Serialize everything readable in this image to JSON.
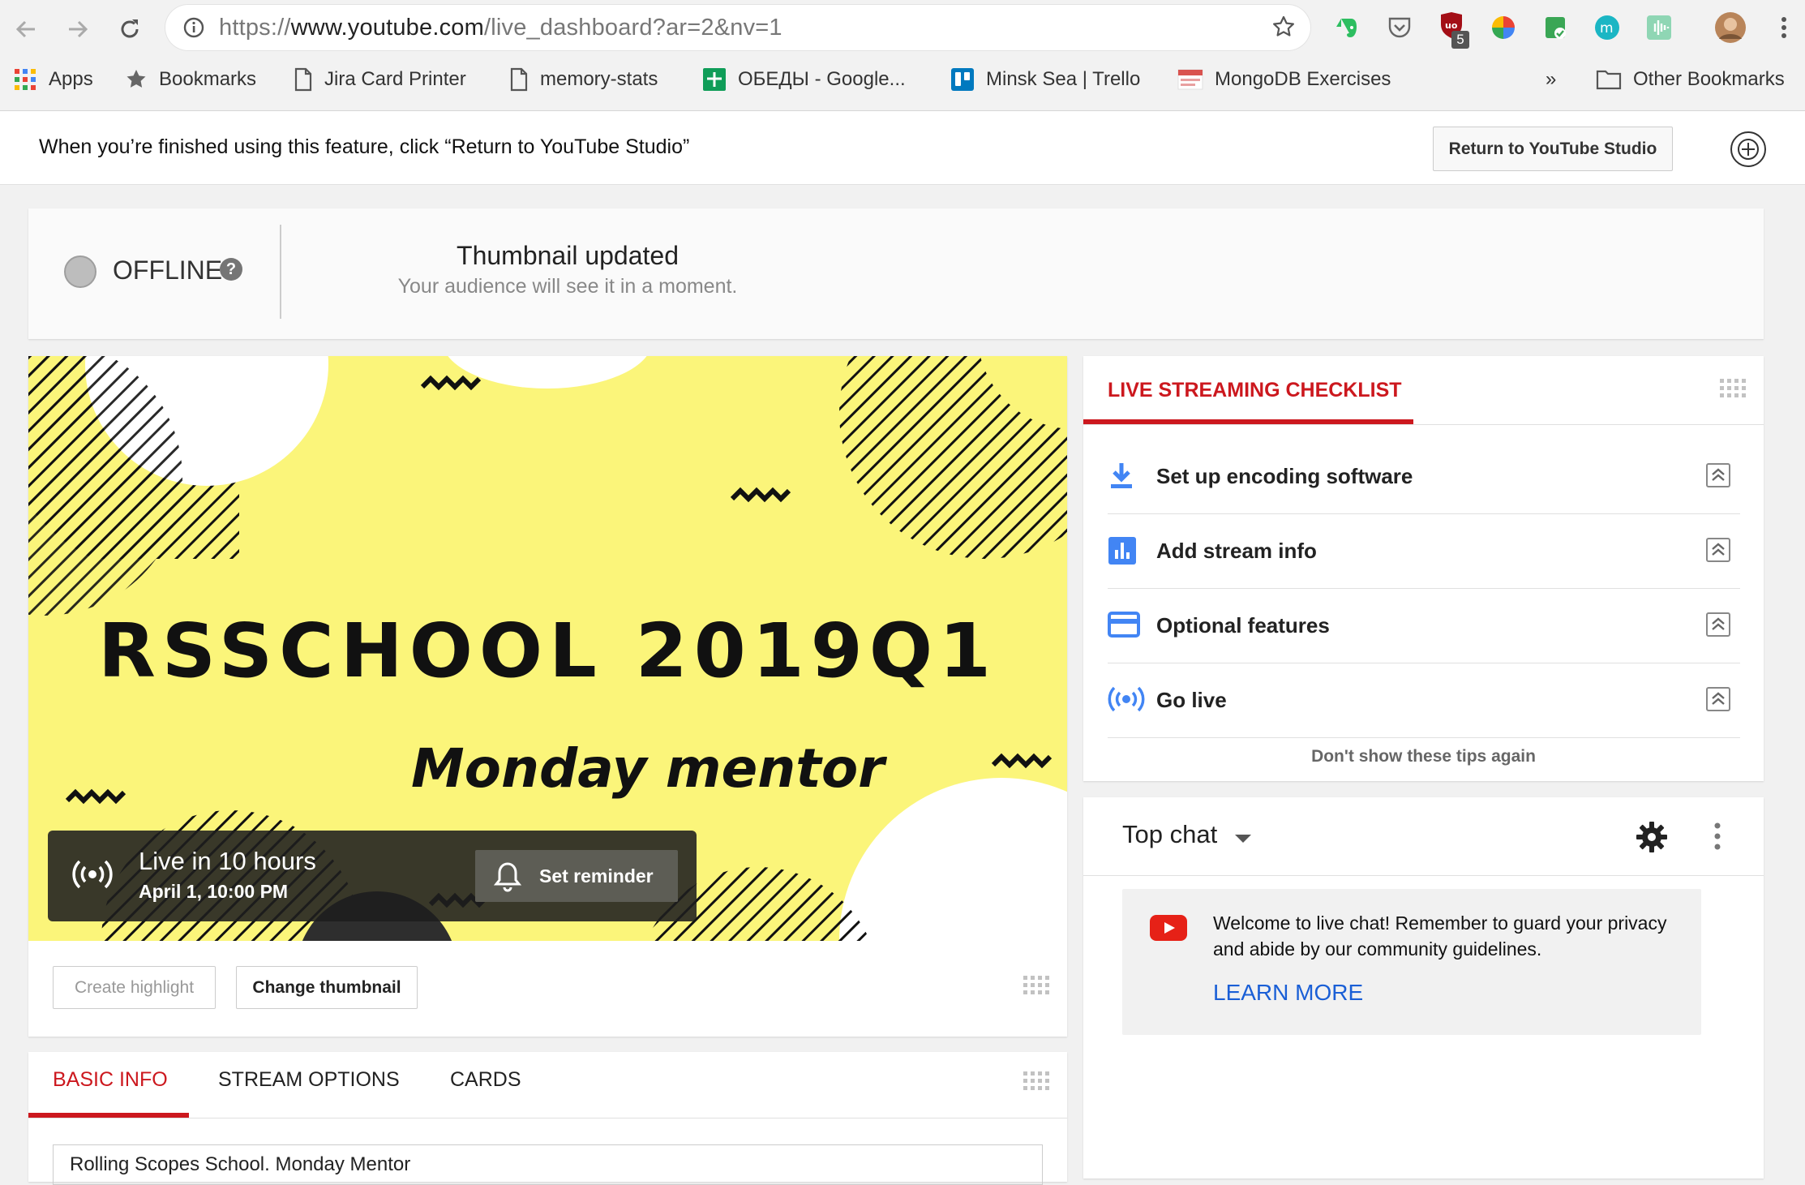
{
  "browser": {
    "url_scheme": "https://",
    "url_host": "www.youtube.com",
    "url_path": "/live_dashboard?ar=2&nv=1",
    "ext_badge": "5",
    "bookmarks": [
      {
        "label": "Apps",
        "icon": "apps-grid-icon"
      },
      {
        "label": "Bookmarks",
        "icon": "star-icon"
      },
      {
        "label": "Jira Card Printer",
        "icon": "page-icon"
      },
      {
        "label": "memory-stats",
        "icon": "page-icon"
      },
      {
        "label": "ОБЕДЫ - Google...",
        "icon": "google-sheets-icon"
      },
      {
        "label": "Minsk Sea | Trello",
        "icon": "trello-icon"
      },
      {
        "label": "MongoDB Exercises",
        "icon": "mongodb-icon"
      }
    ],
    "overflow": "»",
    "other_bookmarks": "Other Bookmarks"
  },
  "notice": {
    "text": "When you’re finished using this feature, click “Return to YouTube Studio”",
    "button": "Return to YouTube Studio"
  },
  "status": {
    "label": "OFFLINE",
    "help": "?",
    "title": "Thumbnail updated",
    "subtitle": "Your audience will see it in a moment."
  },
  "player": {
    "thumb_title": "RSSCHOOL 2019Q1",
    "thumb_subtitle": "Monday mentor",
    "live_in": "Live in 10 hours",
    "live_date": "April 1, 10:00 PM",
    "set_reminder": "Set reminder",
    "create_highlight": "Create highlight",
    "change_thumbnail": "Change thumbnail"
  },
  "tabs": [
    {
      "label": "BASIC INFO"
    },
    {
      "label": "STREAM OPTIONS"
    },
    {
      "label": "CARDS"
    }
  ],
  "basic_info": {
    "title_value": "Rolling Scopes School. Monday Mentor"
  },
  "checklist": {
    "title": "LIVE STREAMING CHECKLIST",
    "items": [
      {
        "label": "Set up encoding software",
        "icon": "download-icon"
      },
      {
        "label": "Add stream info",
        "icon": "bar-chart-icon"
      },
      {
        "label": "Optional features",
        "icon": "card-icon"
      },
      {
        "label": "Go live",
        "icon": "broadcast-icon"
      }
    ],
    "footer": "Don't show these tips again"
  },
  "chat": {
    "mode": "Top chat",
    "welcome": "Welcome to live chat! Remember to guard your privacy and abide by our community guidelines.",
    "learn_more": "LEARN MORE"
  },
  "colors": {
    "accent_red": "#cc181e",
    "link_blue": "#1a5fd6",
    "thumb_yellow": "#fbf57a",
    "icon_blue": "#4285f4"
  }
}
